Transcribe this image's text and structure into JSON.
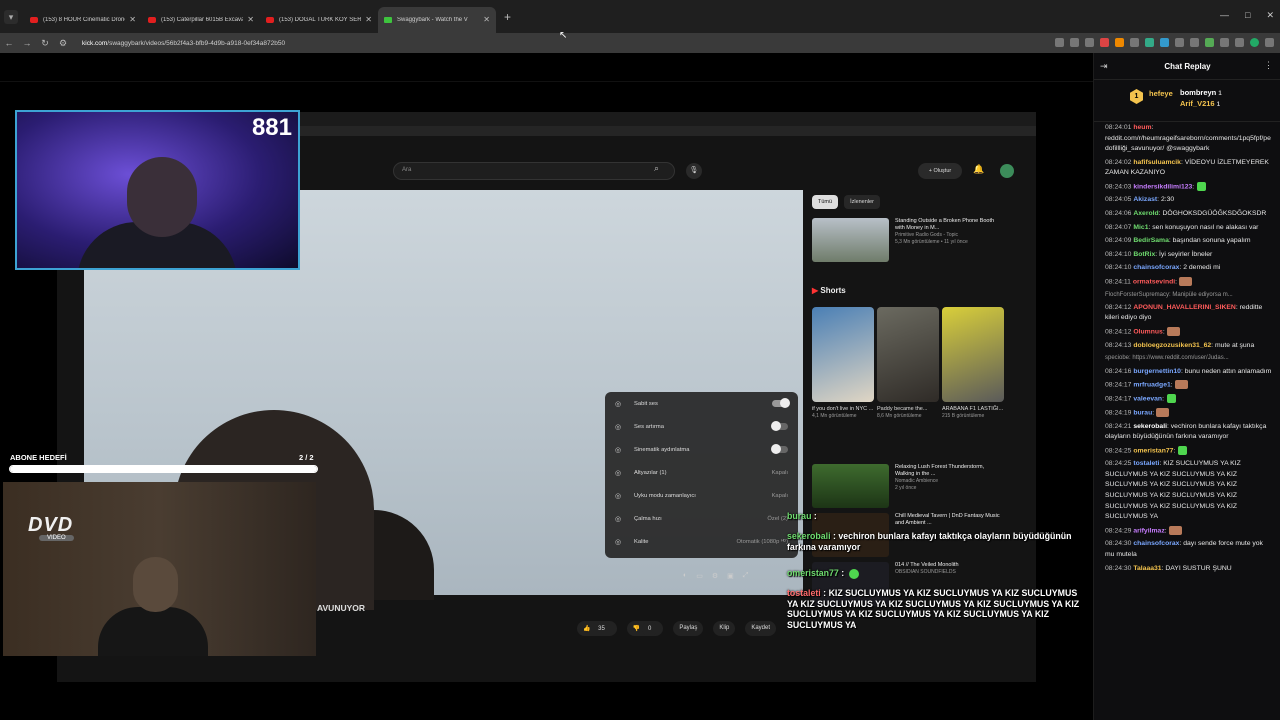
{
  "browser": {
    "tabs": [
      {
        "title": "(153) 8 HOUR Cinematic Drone",
        "site": "youtube"
      },
      {
        "title": "(153) Caterpillar 6015B Excava",
        "site": "youtube"
      },
      {
        "title": "(153) DOĞAL TÜRK KÖY SERPM",
        "site": "youtube"
      },
      {
        "title": "Swaggybark - Watch the V",
        "site": "kick"
      }
    ],
    "url_host": "kick.com",
    "url_path": "/swaggybark/videos/56b2f4a3-bfb9-4d9b-a918-0ef34a872b50"
  },
  "stream": {
    "viewer_count": "881",
    "sub_goal_label": "ABONE HEDEFİ",
    "sub_goal_count": "2 / 2",
    "sub_goal_progress": 1.0,
    "dvd_logo": "DVD",
    "dvd_sub": "VIDEO"
  },
  "inner_youtube": {
    "search_placeholder": "Ara",
    "create_label": "Oluştur",
    "chips": [
      "Tümü",
      "İzlenenler"
    ],
    "video_title": "AVUNUYOR",
    "actions": [
      "35",
      "0",
      "Paylaş",
      "Klip",
      "Kaydet"
    ],
    "settings": [
      {
        "label": "Sabit ses",
        "value": "",
        "toggle": true,
        "on": true,
        "icon": "volume-icon"
      },
      {
        "label": "Ses artırma",
        "value": "",
        "toggle": true,
        "on": false,
        "icon": "volume-boost-icon"
      },
      {
        "label": "Sinematik aydınlatma",
        "value": "",
        "toggle": true,
        "on": false,
        "icon": "ambient-icon"
      },
      {
        "label": "Altyazılar (1)",
        "value": "Kapalı",
        "toggle": false,
        "icon": "subtitles-icon"
      },
      {
        "label": "Uyku modu zamanlayıcı",
        "value": "Kapalı",
        "toggle": false,
        "icon": "sleep-timer-icon"
      },
      {
        "label": "Çalma hızı",
        "value": "Özel (2)",
        "toggle": false,
        "icon": "speed-icon"
      },
      {
        "label": "Kalite",
        "value": "Otomatik (1080p ᴴᴰ)",
        "toggle": false,
        "icon": "quality-icon"
      }
    ],
    "rec1": {
      "title": "Standing Outside a Broken Phone Booth with Money in M...",
      "channel": "Primitive Radio Gods - Topic",
      "meta": "5,3 Mn görüntüleme • 11 yıl önce",
      "duration": "5:37"
    },
    "shorts_label": "Shorts",
    "shorts": [
      {
        "title": "if you don't live in NYC ...",
        "views": "4,1 Mn görüntüleme"
      },
      {
        "title": "Paddy became the...",
        "views": "8,6 Mn görüntüleme"
      },
      {
        "title": "ARABANA F1 LASTIĞI...",
        "views": "215 B görüntüleme"
      }
    ],
    "rec2": {
      "title": "Relaxing Lush Forest Thunderstorm, Walking in the ...",
      "channel": "Nomadic Ambience",
      "meta": "2 yıl önce",
      "duration": "1:13:12"
    },
    "rec3": {
      "title": "Chill Medieval Tavern | DnD Fantasy Music and Ambient ...",
      "channel": "",
      "meta": "",
      "duration": ""
    },
    "rec4": {
      "title": "014 // The Veiled Monolith",
      "channel": "OBSIDIAN SOUNDFIELDS",
      "meta": "",
      "duration": ""
    }
  },
  "overlay_chat": [
    {
      "user": "burau",
      "text": ""
    },
    {
      "user": "sekerobali",
      "text": "vechiron bunlara kafayı taktıkça olayların büyüdüğünün farkına varamıyor"
    },
    {
      "user": "omeristan77",
      "text": ""
    },
    {
      "user": "tostaleti",
      "text": "KIZ SUCLUYMUS YA  KIZ SUCLUYMUS YA  KIZ SUCLUYMUS YA  KIZ SUCLUYMUS YA  KIZ SUCLUYMUS YA  KIZ SUCLUYMUS YA  KIZ SUCLUYMUS YA  KIZ SUCLUYMUS YA  KIZ SUCLUYMUS YA  KIZ SUCLUYMUS YA"
    }
  ],
  "chat": {
    "title": "Chat Replay",
    "pinned": {
      "badge": "1",
      "user1": "hefeye",
      "user2": "bombreyn",
      "rank2": "1",
      "user3": "Arif_V216",
      "rank3": "1"
    },
    "messages": [
      {
        "time": "08:24:01",
        "user": "heum",
        "color": "#ff5b5b",
        "text": "reddit.com/r/heumrageifsareborn/comments/1pq5fpf/pedofillliği_savunuyor/ @swaggybark",
        "extra": ""
      },
      {
        "time": "08:24:02",
        "user": "hafifsuluamcik",
        "color": "#f3c34e",
        "text": "VİDEOYU İZLETMEYEREK ZAMAN KAZANIYO",
        "extra": ""
      },
      {
        "time": "08:24:03",
        "user": "kindersikdilimi123",
        "color": "#c77dff",
        "text": "",
        "extra": "emote"
      },
      {
        "time": "08:24:05",
        "user": "Akizast",
        "color": "#7aa7ff",
        "text": "2:30",
        "extra": ""
      },
      {
        "time": "08:24:06",
        "user": "Axerold",
        "color": "#6fdc6f",
        "text": "DÖGHOKSDGÜÖĞKSDĞOKSDR",
        "extra": ""
      },
      {
        "time": "08:24:07",
        "user": "Mic1",
        "color": "#6fdc6f",
        "text": "sen konuşuyon nasıl ne alakası var",
        "extra": ""
      },
      {
        "time": "08:24:09",
        "user": "BedirSama",
        "color": "#6fdc6f",
        "text": "başından sonuna yapalım",
        "extra": ""
      },
      {
        "time": "08:24:10",
        "user": "BotRix",
        "color": "#6fdc6f",
        "text": "İyi seyirler İbneler",
        "extra": ""
      },
      {
        "time": "08:24:10",
        "user": "chainsofcorax",
        "color": "#7aa7ff",
        "text": "2 demedi mi",
        "extra": ""
      },
      {
        "time": "08:24:11",
        "user": "ormatsevindi",
        "color": "#ff5b5b",
        "text": "",
        "extra": "photo"
      },
      {
        "time": "",
        "user": "",
        "color": "",
        "text": "FlochForsterSupremacy: Manipüle ediyorsa m...",
        "extra": "reply"
      },
      {
        "time": "08:24:12",
        "user": "APONUN_HAVALLERINI_SIKEN",
        "color": "#ff5b5b",
        "text": "redditte kileri ediyo diyo",
        "extra": ""
      },
      {
        "time": "08:24:12",
        "user": "Olumnus",
        "color": "#ff5b5b",
        "text": "",
        "extra": "photo"
      },
      {
        "time": "08:24:13",
        "user": "dobloegzozusiken31_62",
        "color": "#f3c34e",
        "text": "mute at şuna",
        "extra": ""
      },
      {
        "time": "",
        "user": "",
        "color": "",
        "text": "speciobe: https://www.reddit.com/user/Judas...",
        "extra": "reply"
      },
      {
        "time": "08:24:16",
        "user": "burgernettin10",
        "color": "#7aa7ff",
        "text": "bunu neden attın anlamadım",
        "extra": ""
      },
      {
        "time": "08:24:17",
        "user": "mrfruadge1",
        "color": "#7aa7ff",
        "text": "",
        "extra": "photo"
      },
      {
        "time": "08:24:17",
        "user": "valeevan",
        "color": "#7aa7ff",
        "text": "",
        "extra": "emote"
      },
      {
        "time": "08:24:19",
        "user": "burau",
        "color": "#7aa7ff",
        "text": "",
        "extra": "photo"
      },
      {
        "time": "08:24:21",
        "user": "sekerobali",
        "color": "#fff",
        "text": "vechiron bunlara kafayı taktıkça olayların büyüdüğünün farkına varamıyor",
        "extra": ""
      },
      {
        "time": "08:24:25",
        "user": "omeristan77",
        "color": "#f3c34e",
        "text": "",
        "extra": "emote"
      },
      {
        "time": "08:24:25",
        "user": "tostaleti",
        "color": "#7aa7ff",
        "text": "KIZ SUCLUYMUS YA  KIZ SUCLUYMUS YA  KIZ SUCLUYMUS YA  KIZ SUCLUYMUS YA  KIZ SUCLUYMUS YA  KIZ SUCLUYMUS YA  KIZ SUCLUYMUS YA  KIZ SUCLUYMUS YA  KIZ SUCLUYMUS YA  KIZ SUCLUYMUS YA",
        "extra": ""
      },
      {
        "time": "08:24:29",
        "user": "arifyilmaz",
        "color": "#c77dff",
        "text": "",
        "extra": "photo"
      },
      {
        "time": "08:24:30",
        "user": "chainsofcorax",
        "color": "#7aa7ff",
        "text": "dayı sende force mute yok mu mutela",
        "extra": ""
      },
      {
        "time": "08:24:30",
        "user": "Talaaa31",
        "color": "#f3c34e",
        "text": "DAYI SUSTUR ŞUNU",
        "extra": ""
      }
    ]
  }
}
